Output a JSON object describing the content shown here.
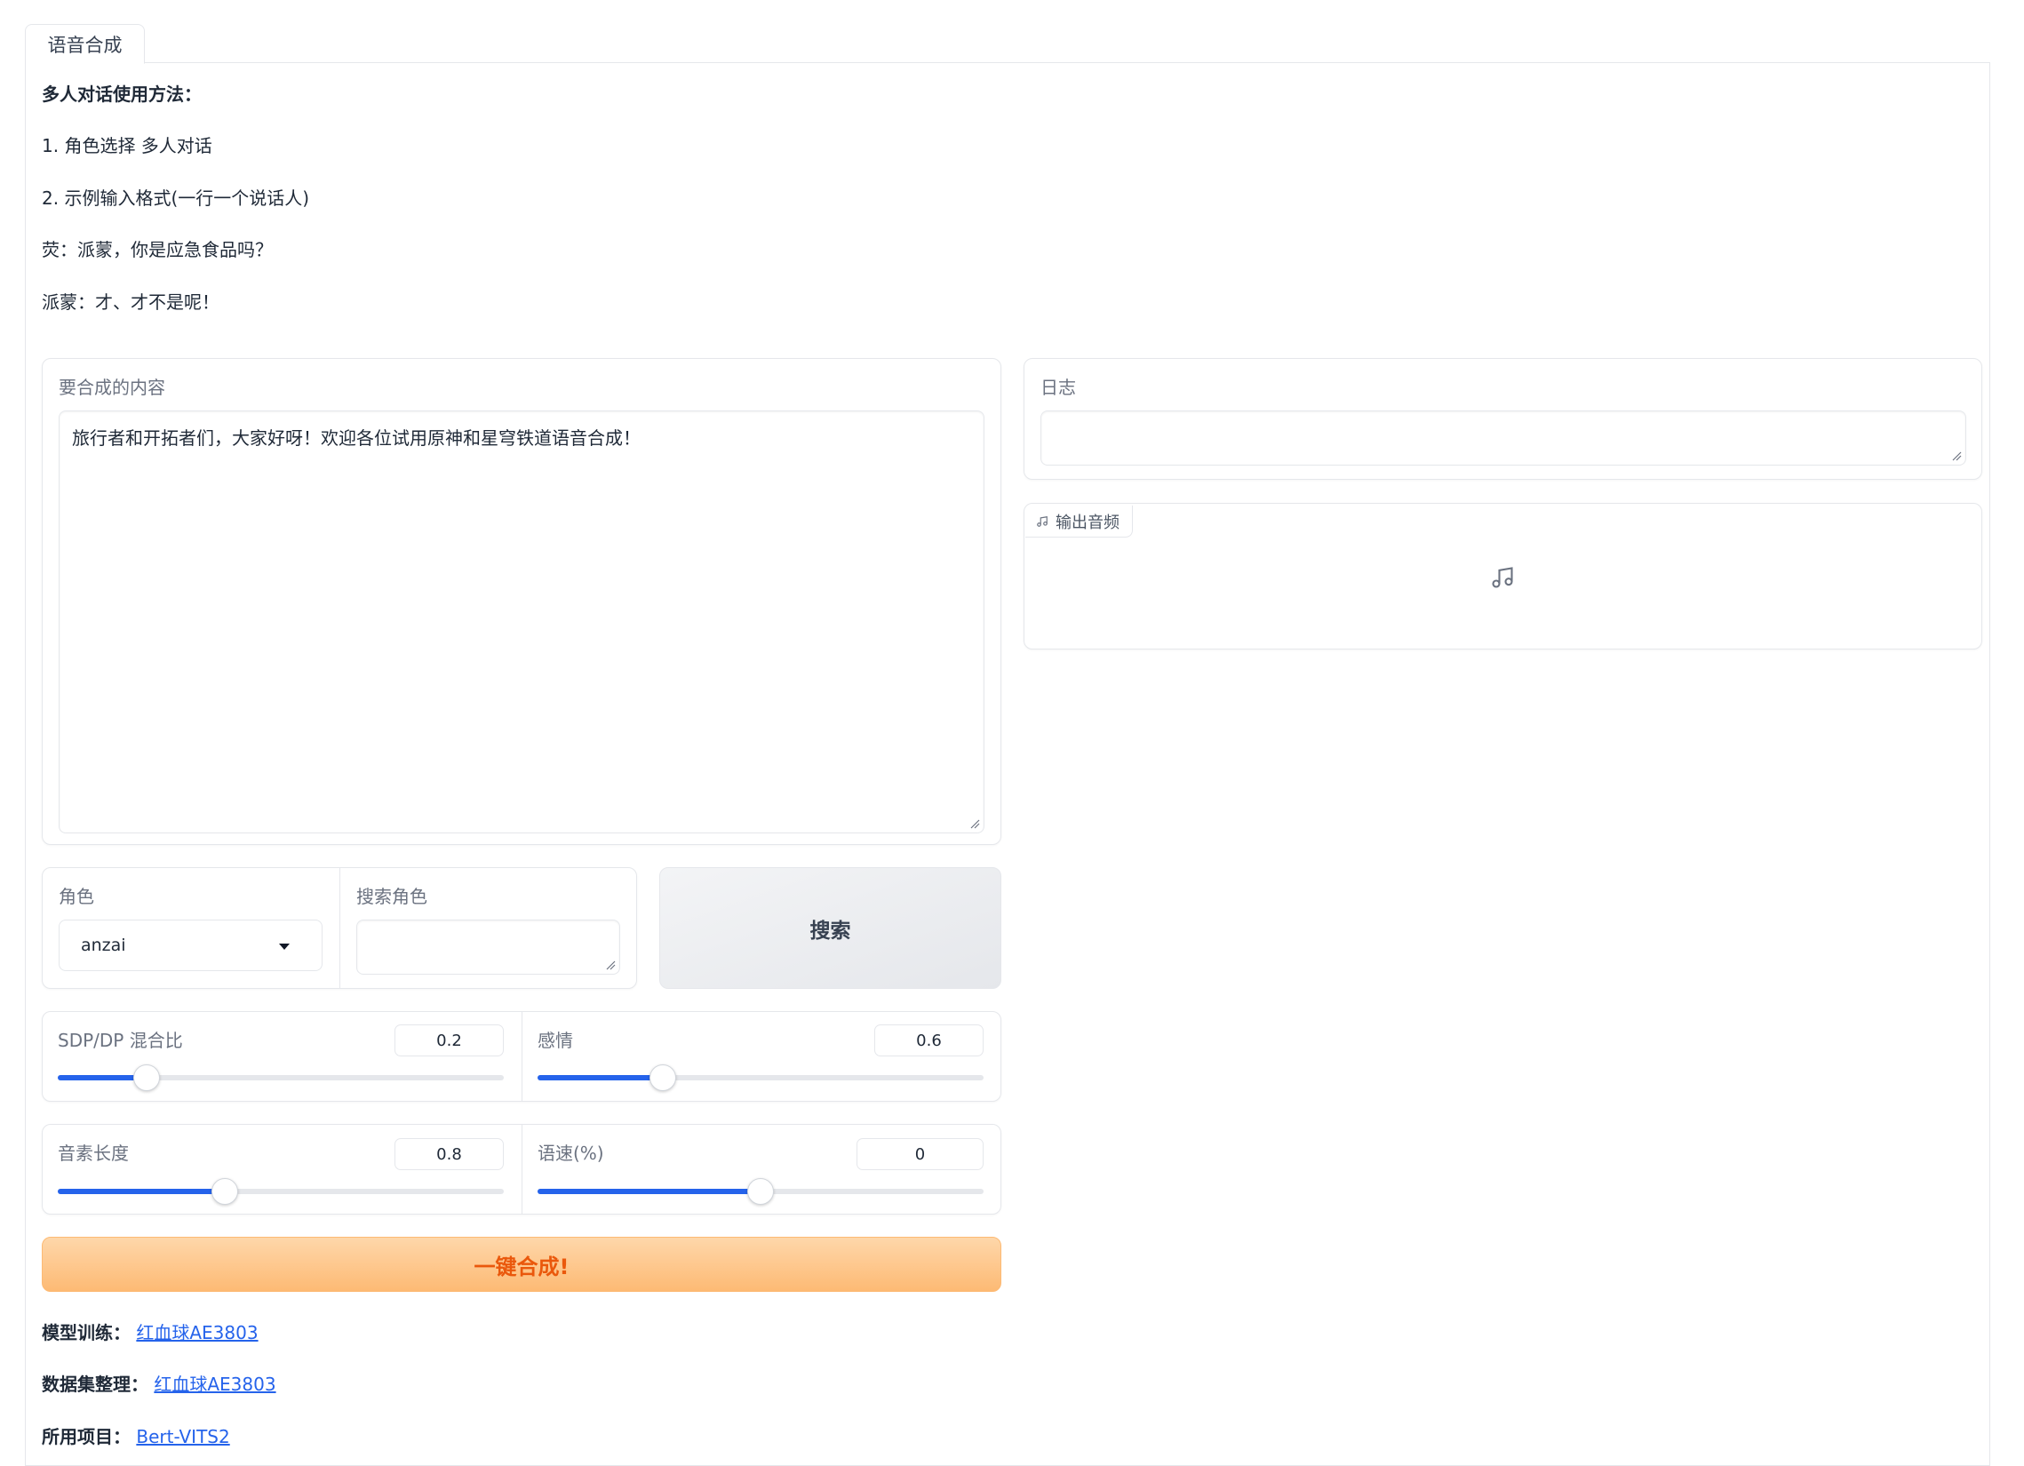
{
  "tabs": [
    {
      "label": "语音合成"
    }
  ],
  "instructions": {
    "title": "多人对话使用方法：",
    "step1": "1. 角色选择 多人对话",
    "step2": "2. 示例输入格式(一行一个说话人)",
    "example1": "荧：派蒙，你是应急食品吗？",
    "example2": "派蒙：才、才不是呢！"
  },
  "content": {
    "label": "要合成的内容",
    "value": "旅行者和开拓者们，大家好呀！欢迎各位试用原神和星穹铁道语音合成！"
  },
  "role": {
    "label": "角色",
    "selected": "anzai"
  },
  "search_role": {
    "label": "搜索角色",
    "value": ""
  },
  "search_button": {
    "label": "搜索"
  },
  "sliders": {
    "sdp": {
      "label": "SDP/DP 混合比",
      "value": "0.2",
      "fraction": 0.2
    },
    "emotion": {
      "label": "感情",
      "value": "0.6",
      "fraction": 0.28
    },
    "phoneme": {
      "label": "音素长度",
      "value": "0.8",
      "fraction": 0.375
    },
    "speed": {
      "label": "语速(%)",
      "value": "0",
      "fraction": 0.5
    }
  },
  "synthesize_button": {
    "label": "一键合成!"
  },
  "log": {
    "label": "日志",
    "value": ""
  },
  "output_audio": {
    "label": "输出音频"
  },
  "credits": {
    "training_label": "模型训练：",
    "training_link": "红血球AE3803",
    "dataset_label": "数据集整理：",
    "dataset_link": "红血球AE3803",
    "project_label": "所用项目：",
    "project_link": "Bert-VITS2"
  },
  "colors": {
    "accent": "#2563eb",
    "primary_orange": "#ea580c"
  }
}
